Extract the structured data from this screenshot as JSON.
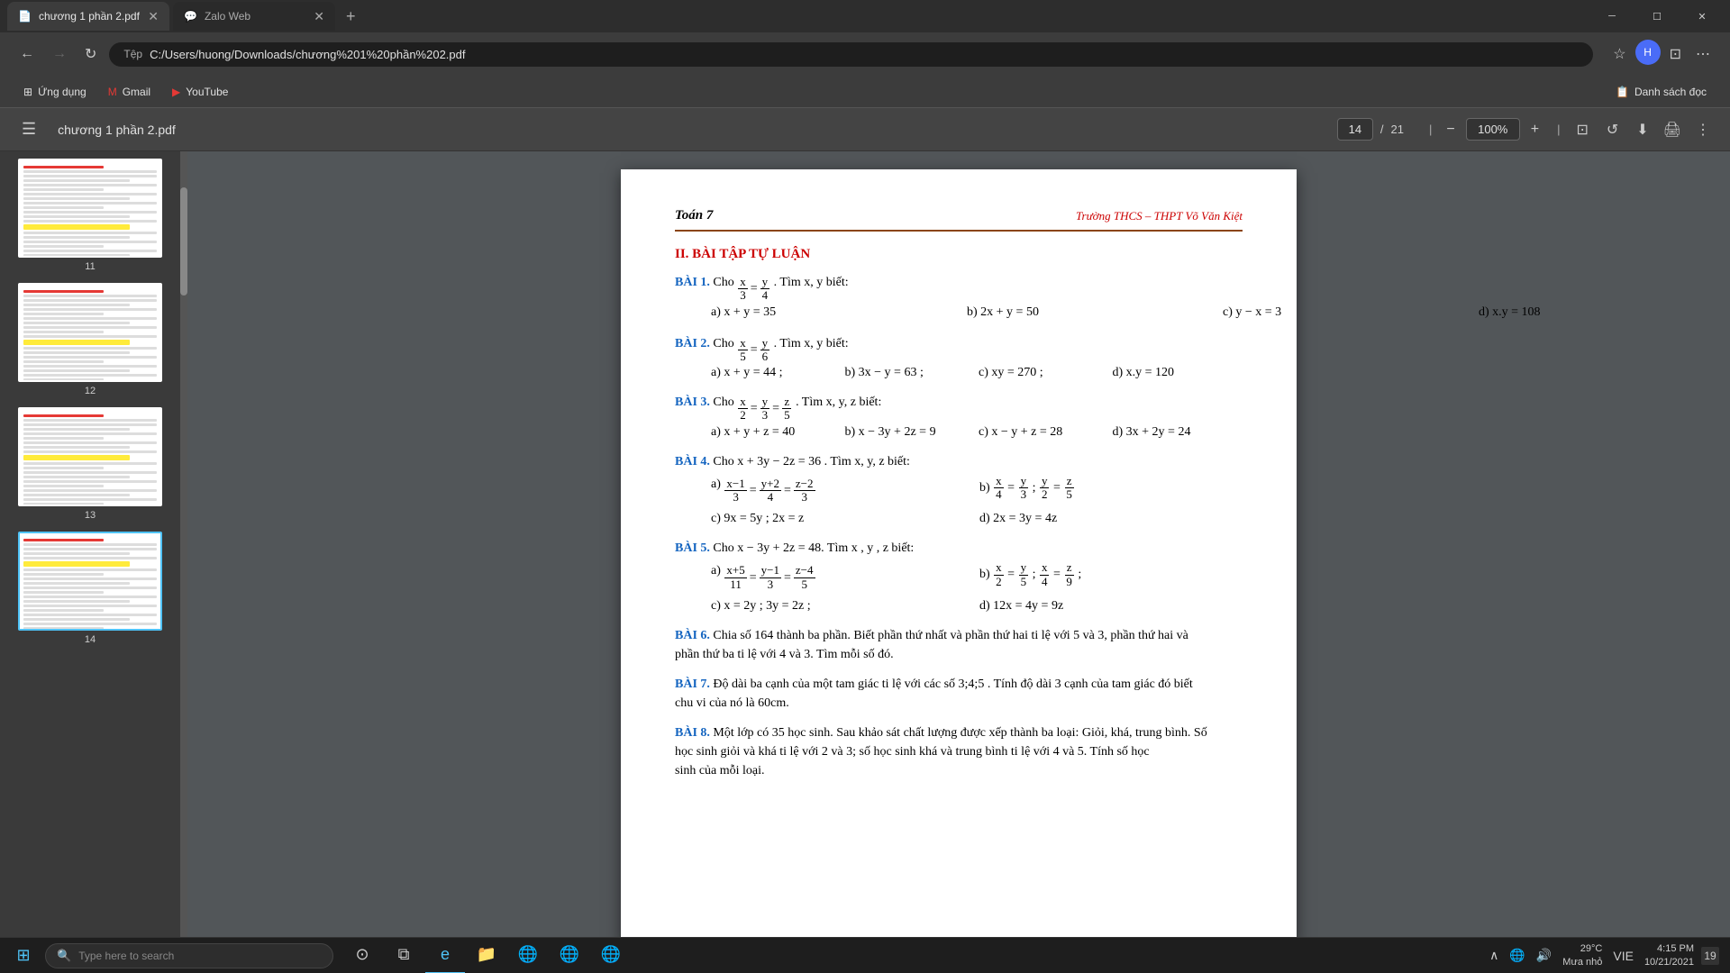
{
  "browser": {
    "tabs": [
      {
        "id": "tab1",
        "title": "chương 1 phần 2.pdf",
        "active": true,
        "icon": "📄"
      },
      {
        "id": "tab2",
        "title": "Zalo Web",
        "active": false,
        "icon": "💬"
      }
    ],
    "address": "C:/Users/huong/Downloads/chương%201%20phần%202.pdf",
    "address_prefix": "Tệp",
    "bookmarks": [
      {
        "label": "Ứng dụng",
        "icon": "⊞"
      },
      {
        "label": "Gmail",
        "icon": "✉"
      },
      {
        "label": "YouTube",
        "icon": "▶"
      }
    ],
    "reading_list": "Danh sách đọc"
  },
  "pdf": {
    "title": "chương 1 phần 2.pdf",
    "current_page": "14",
    "total_pages": "21",
    "zoom": "100%",
    "thumbnails": [
      {
        "num": "11"
      },
      {
        "num": "12"
      },
      {
        "num": "13"
      },
      {
        "num": "14",
        "active": true
      }
    ]
  },
  "page_content": {
    "header_left": "Toán 7",
    "header_right": "Trường THCS – THPT Võ Văn Kiệt",
    "section_title": "II. BÀI TẬP TỰ LUẬN",
    "exercises": [
      {
        "num": "BÀI 1.",
        "text": " Cho x/3 = y/4 . Tìm x, y biết:",
        "parts": [
          "a) x + y = 35",
          "b) 2x + y = 50",
          "c) y − x = 3",
          "d)  x.y = 108"
        ]
      },
      {
        "num": "BÀI 2.",
        "text": " Cho x/5 = y/6 . Tìm x,  y  biết:",
        "parts": [
          "a) x + y = 44 ;",
          "b) 3x − y = 63 ;",
          "c) xy = 270 ;",
          "d) x.y = 120"
        ]
      },
      {
        "num": "BÀI 3.",
        "text": " Cho x/2 = y/3 = z/5 . Tìm x, y, z  biết:",
        "parts": [
          "a) x + y + z = 40",
          "b) x − 3y + 2z = 9",
          "c) x − y + z = 28",
          "d)  3x + 2y = 24"
        ]
      },
      {
        "num": "BÀI 4.",
        "text": " Cho x + 3y − 2z = 36 . Tìm x, y, z  biết:",
        "subparts_a": "(x−1)/3 = (y+2)/4 = (z−2)/3",
        "subparts_b": "x/4 = y/3 ; y/2 = z/5",
        "subparts_c": "9x = 5y ; 2x = z",
        "subparts_d": "2x = 3y = 4z"
      },
      {
        "num": "BÀI 5.",
        "text": " Cho x − 3y + 2z = 48. Tìm x , y , z  biết:",
        "subparts_a": "(x+5)/11 = (y−1)/3 = (z−4)/5",
        "subparts_b": "x/2 = y/5 ; x/4 = z/9 ;",
        "subparts_c": "c)  x = 2y ; 3y = 2z ;",
        "subparts_d": "d) 12x = 4y = 9z"
      },
      {
        "num": "BÀI 6.",
        "text": "     Chia số 164 thành ba phần. Biết phần thứ nhất và phần thứ hai ti lệ với 5 và 3, phần thứ hai và phần thứ ba ti lệ với 4 và 3. Tìm mỗi số đó."
      },
      {
        "num": "BÀI 7.",
        "text": "     Độ dài ba cạnh của một tam giác ti lệ với các số 3;4;5 . Tính độ dài 3 cạnh của tam giác đó biết chu vi của nó là 60cm."
      },
      {
        "num": "BÀI 8.",
        "text": "     Một lớp có 35 học sinh. Sau khảo sát chất lượng được xếp thành ba loại: Giỏi, khá, trung bình. Số học sinh giỏi và khá ti lệ với 2 và 3; số học sinh khá và trung bình ti lệ với 4 và 5. Tính số học sinh của mỗi loại."
      }
    ]
  },
  "taskbar": {
    "search_placeholder": "Type here to search",
    "time": "4:15 PM",
    "date": "10/21/2021",
    "temperature": "29°C",
    "weather": "Mưa nhỏ",
    "language": "VIE",
    "notification_num": "19"
  }
}
